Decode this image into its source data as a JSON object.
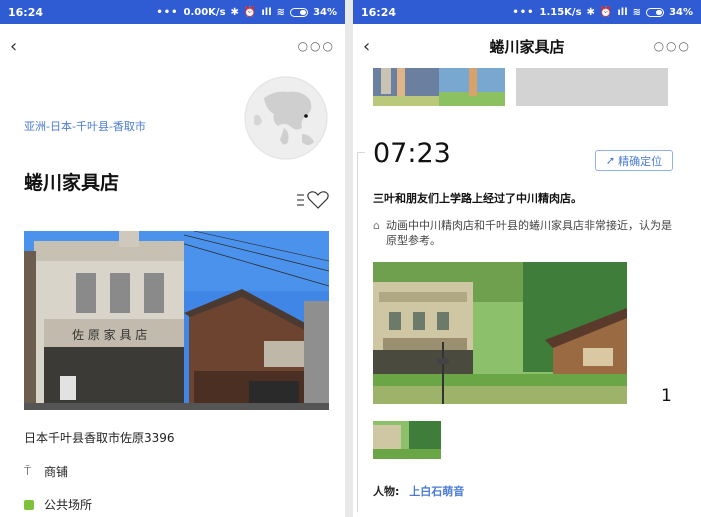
{
  "left": {
    "status": {
      "time": "16:24",
      "speed": "0.00K/s",
      "battery": "34%"
    },
    "nav": {
      "back_icon": "back-arrow-icon",
      "more_icon": "more-dots-icon"
    },
    "breadcrumb": "亚洲-日本-千叶县-香取市",
    "title": "蜷川家具店",
    "address": "日本千叶县香取市佐原3396",
    "categories": [
      {
        "icon": "fork-icon",
        "label": "商铺"
      },
      {
        "icon": "green-square-icon",
        "label": "公共场所",
        "color": "#7cc33a"
      }
    ],
    "photo_sign": "佐 原 家 具 店"
  },
  "right": {
    "status": {
      "time": "16:24",
      "speed": "1.15K/s",
      "battery": "34%"
    },
    "nav": {
      "title": "蜷川家具店"
    },
    "scene": {
      "time": "07:23",
      "locate_label": "精确定位",
      "title": "三叶和朋友们上学路上经过了中川精肉店。",
      "note": "动画中中川精肉店和千叶县的蜷川家具店非常接近，认为是原型参考。",
      "counter": "1",
      "person_label": "人物:",
      "person_name": "上白石萌音"
    }
  },
  "colors": {
    "statusbar": "#2f5bd3",
    "link": "#4b7bd6",
    "green": "#7cc33a"
  }
}
